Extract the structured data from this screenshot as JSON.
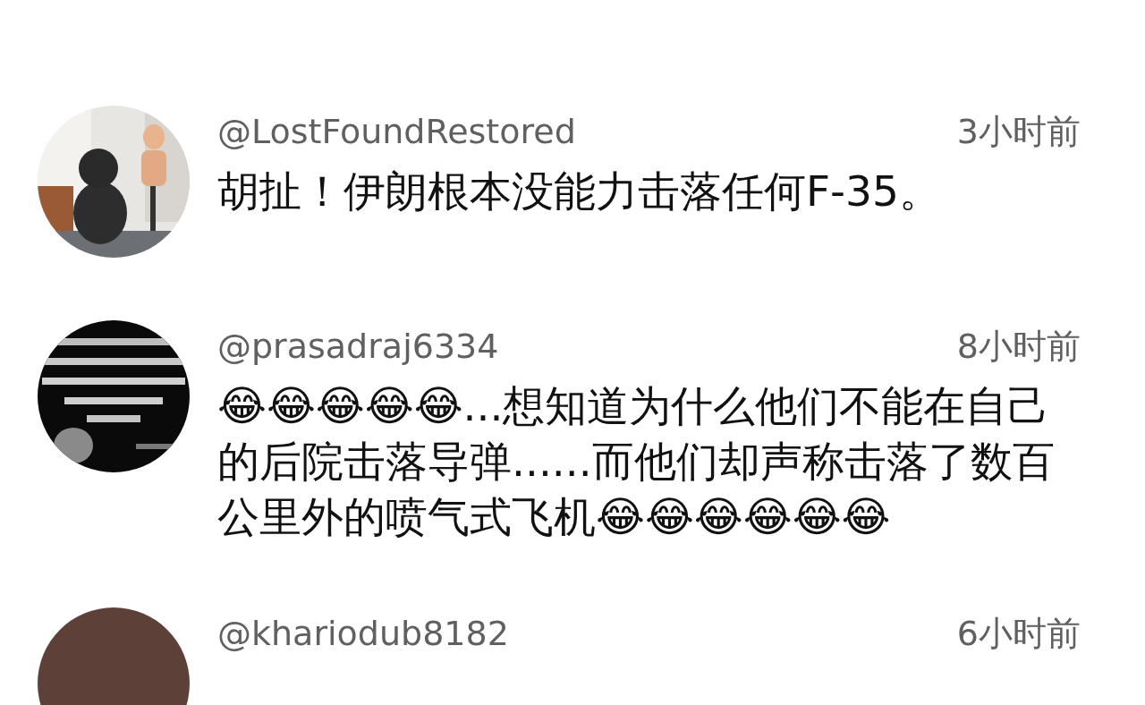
{
  "comments": [
    {
      "username": "@LostFoundRestored",
      "time": "3小时前",
      "text": "胡扯！伊朗根本没能力击落任何F-35。"
    },
    {
      "username": "@prasadraj6334",
      "time": "8小时前",
      "text": "😂😂😂😂😂...想知道为什么他们不能在自己的后院击落导弹......而他们却声称击落了数百公里外的喷气式飞机😂😂😂😂😂😂"
    },
    {
      "avatar": {
        "kind": "plain",
        "color": "#5d4037"
      },
      "username": "@khariodub8182",
      "time": "6小时前"
    }
  ]
}
